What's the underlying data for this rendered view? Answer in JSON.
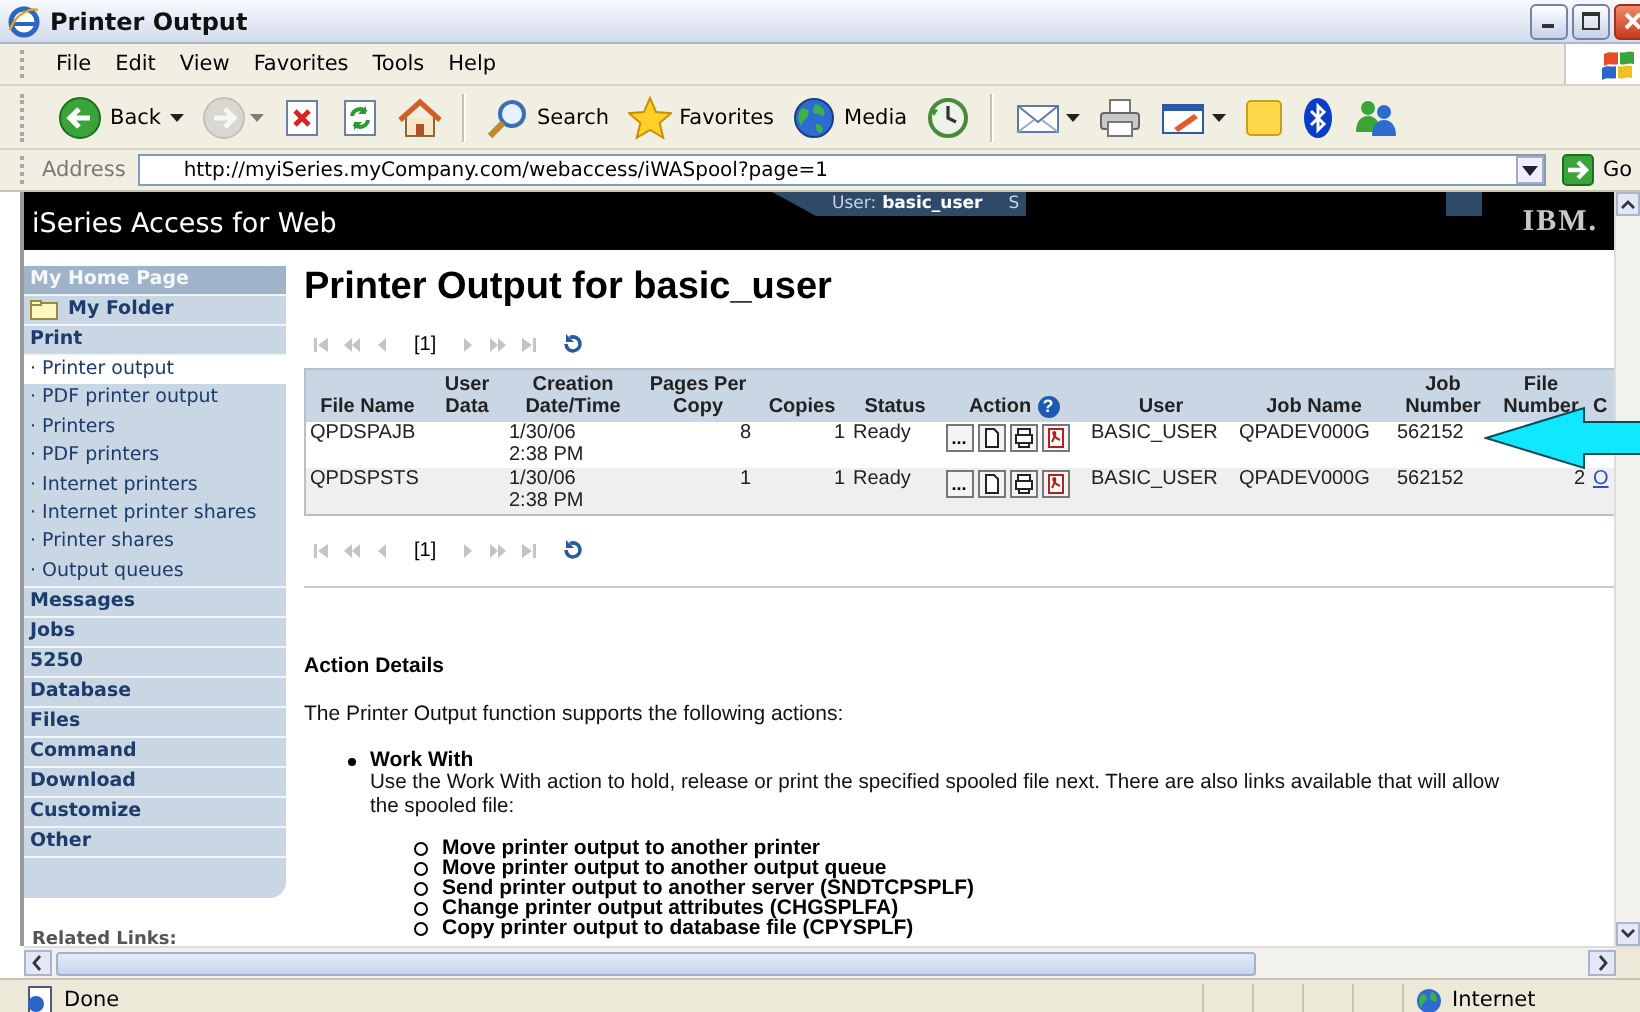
{
  "window": {
    "title": "Printer Output"
  },
  "menu": [
    {
      "label": "File"
    },
    {
      "label": "Edit"
    },
    {
      "label": "View"
    },
    {
      "label": "Favorites"
    },
    {
      "label": "Tools"
    },
    {
      "label": "Help"
    }
  ],
  "toolbar": [
    {
      "kind": "back",
      "label": "Back",
      "dropdown": true,
      "disabled": false
    },
    {
      "kind": "forward",
      "dropdown": true,
      "disabled": true
    },
    {
      "kind": "stop",
      "dropdown": false,
      "disabled": false
    },
    {
      "kind": "refresh",
      "dropdown": false,
      "disabled": false
    },
    {
      "kind": "home",
      "dropdown": false,
      "disabled": false
    },
    {
      "kind": "separator"
    },
    {
      "kind": "search",
      "label": "Search",
      "dropdown": false,
      "disabled": false
    },
    {
      "kind": "favorites",
      "label": "Favorites",
      "dropdown": false,
      "disabled": false
    },
    {
      "kind": "media",
      "label": "Media",
      "dropdown": false,
      "disabled": false
    },
    {
      "kind": "history",
      "dropdown": false,
      "disabled": false
    },
    {
      "kind": "separator"
    },
    {
      "kind": "mail",
      "dropdown": true,
      "disabled": false
    },
    {
      "kind": "print",
      "dropdown": false,
      "disabled": false
    },
    {
      "kind": "edit",
      "dropdown": true,
      "disabled": false
    },
    {
      "kind": "notes",
      "dropdown": false,
      "disabled": false
    },
    {
      "kind": "bluetooth",
      "dropdown": false,
      "disabled": false
    },
    {
      "kind": "messenger",
      "dropdown": false,
      "disabled": false
    }
  ],
  "address": {
    "label": "Address",
    "value": "http://myiSeries.myCompany.com/webaccess/iWASpool?page=1",
    "go": "Go"
  },
  "banner": {
    "product": "iSeries Access for Web",
    "user_label": "User:",
    "user": "basic_user",
    "next_tab": "S",
    "logo": "IBM."
  },
  "sidebar": {
    "items": [
      {
        "kind": "home",
        "label": "My Home Page"
      },
      {
        "kind": "folder",
        "label": "My Folder"
      },
      {
        "kind": "section",
        "label": "Print",
        "children": [
          {
            "label": "· Printer output",
            "selected": true
          },
          {
            "label": "· PDF printer output",
            "selected": false
          },
          {
            "label": "· Printers",
            "selected": false
          },
          {
            "label": "· PDF printers",
            "selected": false
          },
          {
            "label": "· Internet printers",
            "selected": false
          },
          {
            "label": "· Internet printer shares",
            "selected": false
          },
          {
            "label": "· Printer shares",
            "selected": false
          },
          {
            "label": "· Output queues",
            "selected": false
          }
        ]
      },
      {
        "kind": "section",
        "label": "Messages"
      },
      {
        "kind": "section",
        "label": "Jobs"
      },
      {
        "kind": "section",
        "label": "5250"
      },
      {
        "kind": "section",
        "label": "Database"
      },
      {
        "kind": "section",
        "label": "Files"
      },
      {
        "kind": "section",
        "label": "Command"
      },
      {
        "kind": "section",
        "label": "Download"
      },
      {
        "kind": "section",
        "label": "Customize"
      },
      {
        "kind": "section",
        "label": "Other"
      }
    ],
    "related_links": "Related Links:"
  },
  "main": {
    "title": "Printer Output for basic_user",
    "pagers": [
      {
        "page": "[1]"
      },
      {
        "page": "[1]"
      }
    ],
    "table": {
      "columns": [
        {
          "label": "File Name"
        },
        {
          "label": "User Data"
        },
        {
          "label": "Creation Date/Time"
        },
        {
          "label": "Pages Per Copy"
        },
        {
          "label": "Copies"
        },
        {
          "label": "Status"
        },
        {
          "label": "Action",
          "help": "?"
        },
        {
          "label": "User"
        },
        {
          "label": "Job Name"
        },
        {
          "label": "Job Number"
        },
        {
          "label": "File Number"
        },
        {
          "label": "C"
        }
      ],
      "rows": [
        {
          "file_name": "QPDSPAJB",
          "created": "1/30/06 2:38 PM",
          "pages_per_copy": "8",
          "copies": "1",
          "status": "Ready",
          "actions": [
            {
              "kind": "more",
              "label": "..."
            },
            {
              "kind": "view"
            },
            {
              "kind": "print"
            },
            {
              "kind": "pdf"
            }
          ],
          "user": "BASIC_USER",
          "job_name": "QPADEV000G",
          "job_number": "562152"
        },
        {
          "file_name": "QPDSPSTS",
          "created": "1/30/06 2:38 PM",
          "pages_per_copy": "1",
          "copies": "1",
          "status": "Ready",
          "actions": [
            {
              "kind": "more",
              "label": "..."
            },
            {
              "kind": "view"
            },
            {
              "kind": "print"
            },
            {
              "kind": "pdf"
            }
          ],
          "user": "BASIC_USER",
          "job_name": "QPADEV000G",
          "job_number": "562152",
          "file_number": "2",
          "column_12": "O"
        }
      ]
    },
    "details": {
      "heading": "Action Details",
      "intro": "The Printer Output function supports the following actions:",
      "actions": [
        {
          "title": "Work With",
          "lines": [
            "Use the Work With action to hold, release or print the specified spooled file next. There are also links available that will allow",
            "the spooled file:"
          ],
          "links": [
            "Move printer output to another printer",
            "Move printer output to another output queue",
            "Send printer output to another server (SNDTCPSPLF)",
            "Change printer output attributes (CHGSPLFA)",
            "Copy printer output to database file (CPYSPLF)"
          ]
        }
      ]
    }
  },
  "status_bar": {
    "text": "Done",
    "zone": "Internet"
  }
}
